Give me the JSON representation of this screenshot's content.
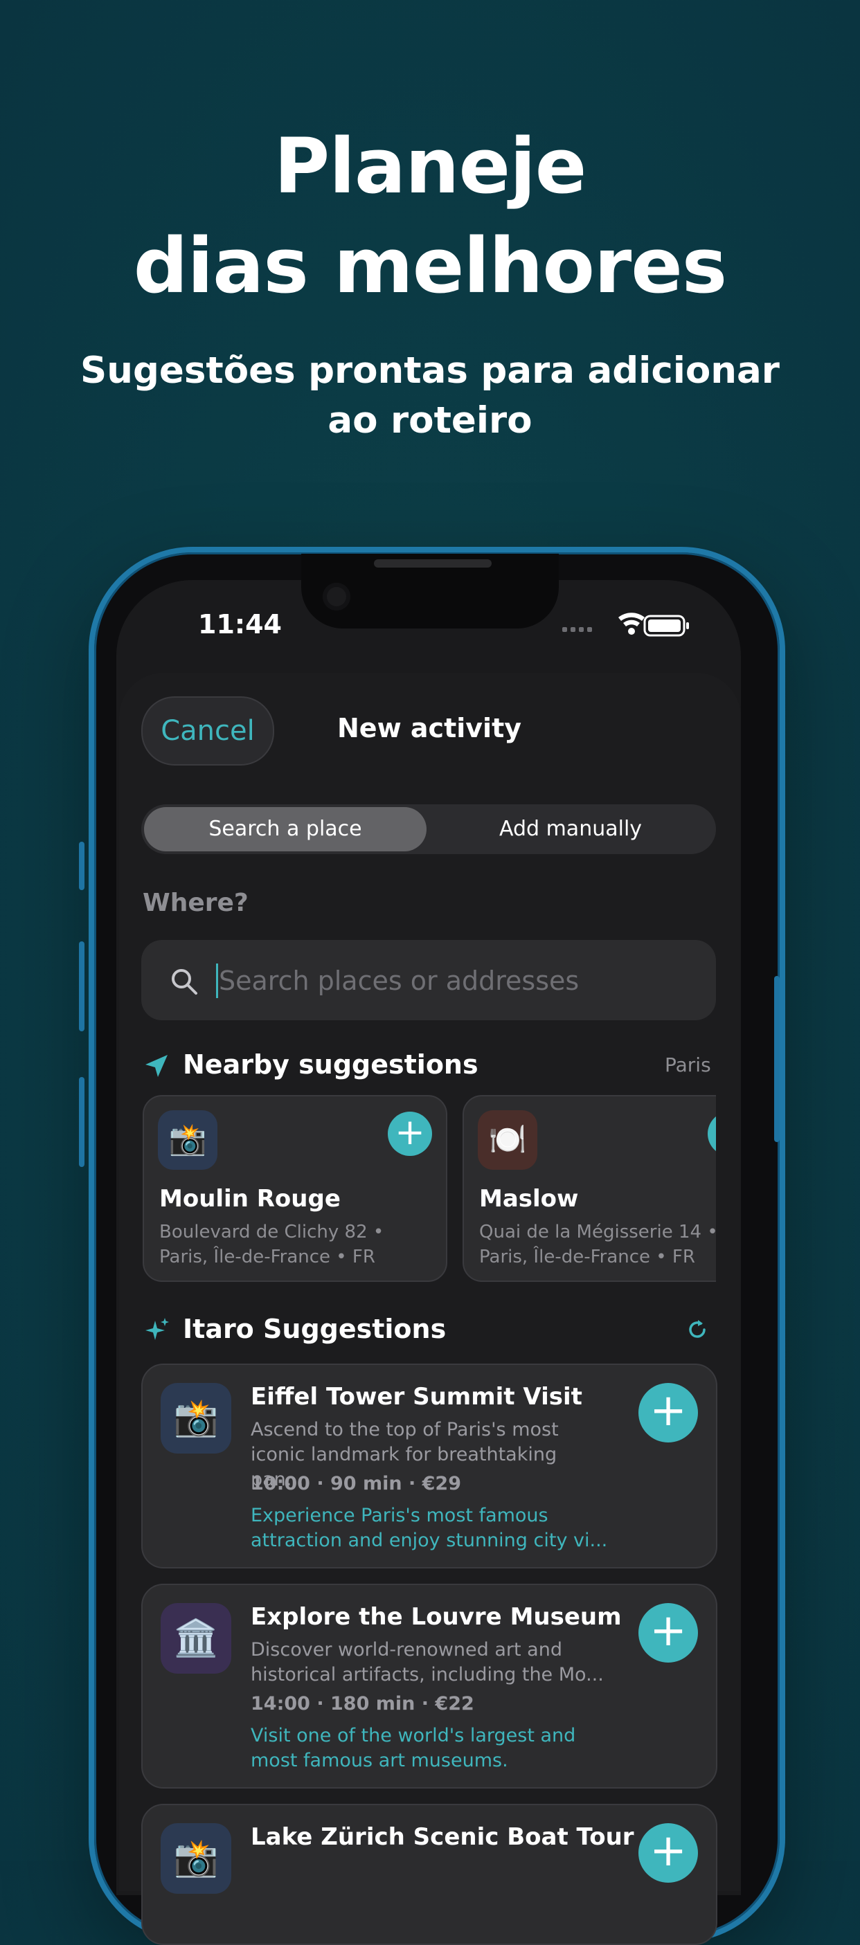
{
  "hero": {
    "title_line1": "Planeje",
    "title_line2": "dias melhores",
    "subtitle": "Sugestões prontas para adicionar ao roteiro"
  },
  "status_bar": {
    "time": "11:44"
  },
  "sheet": {
    "cancel_label": "Cancel",
    "title": "New activity",
    "tabs": [
      {
        "label": "Search a place",
        "selected": true
      },
      {
        "label": "Add manually",
        "selected": false
      }
    ],
    "where_label": "Where?",
    "search_placeholder": "Search places or addresses",
    "search_value": ""
  },
  "nearby": {
    "heading": "Nearby suggestions",
    "city": "Paris",
    "items": [
      {
        "icon": "📸",
        "tile_color": "#2c3a52",
        "name": "Moulin Rouge",
        "address": "Boulevard de Clichy 82 • Paris, Île-de-France • FR"
      },
      {
        "icon": "🍽️",
        "tile_color": "#4a2e2a",
        "name": "Maslow",
        "address": "Quai de la Mégisserie 14 • Paris, Île-de-France • FR"
      }
    ]
  },
  "itaro": {
    "heading": "Itaro Suggestions",
    "items": [
      {
        "icon": "📸",
        "tile_color": "#2c3a52",
        "title": "Eiffel Tower Summit Visit",
        "description": "Ascend to the top of Paris's most iconic landmark for breathtaking pan...",
        "meta": "10:00 · 90 min · €29",
        "reason": "Experience Paris's most famous attraction and enjoy stunning city vi..."
      },
      {
        "icon": "🏛️",
        "tile_color": "#3a2f52",
        "title": "Explore the Louvre Museum",
        "description": "Discover world-renowned art and historical artifacts, including the Mo...",
        "meta": "14:00 · 180 min · €22",
        "reason": "Visit one of the world's largest and most famous art museums."
      },
      {
        "icon": "📸",
        "tile_color": "#2c3a52",
        "title": "Lake Zürich Scenic Boat Tour",
        "description": "",
        "meta": "",
        "reason": ""
      }
    ]
  },
  "colors": {
    "accent": "#3fb6bd",
    "background": "#0b3b45",
    "card": "#2c2c2e",
    "phone_frame": "#1f79a8"
  }
}
